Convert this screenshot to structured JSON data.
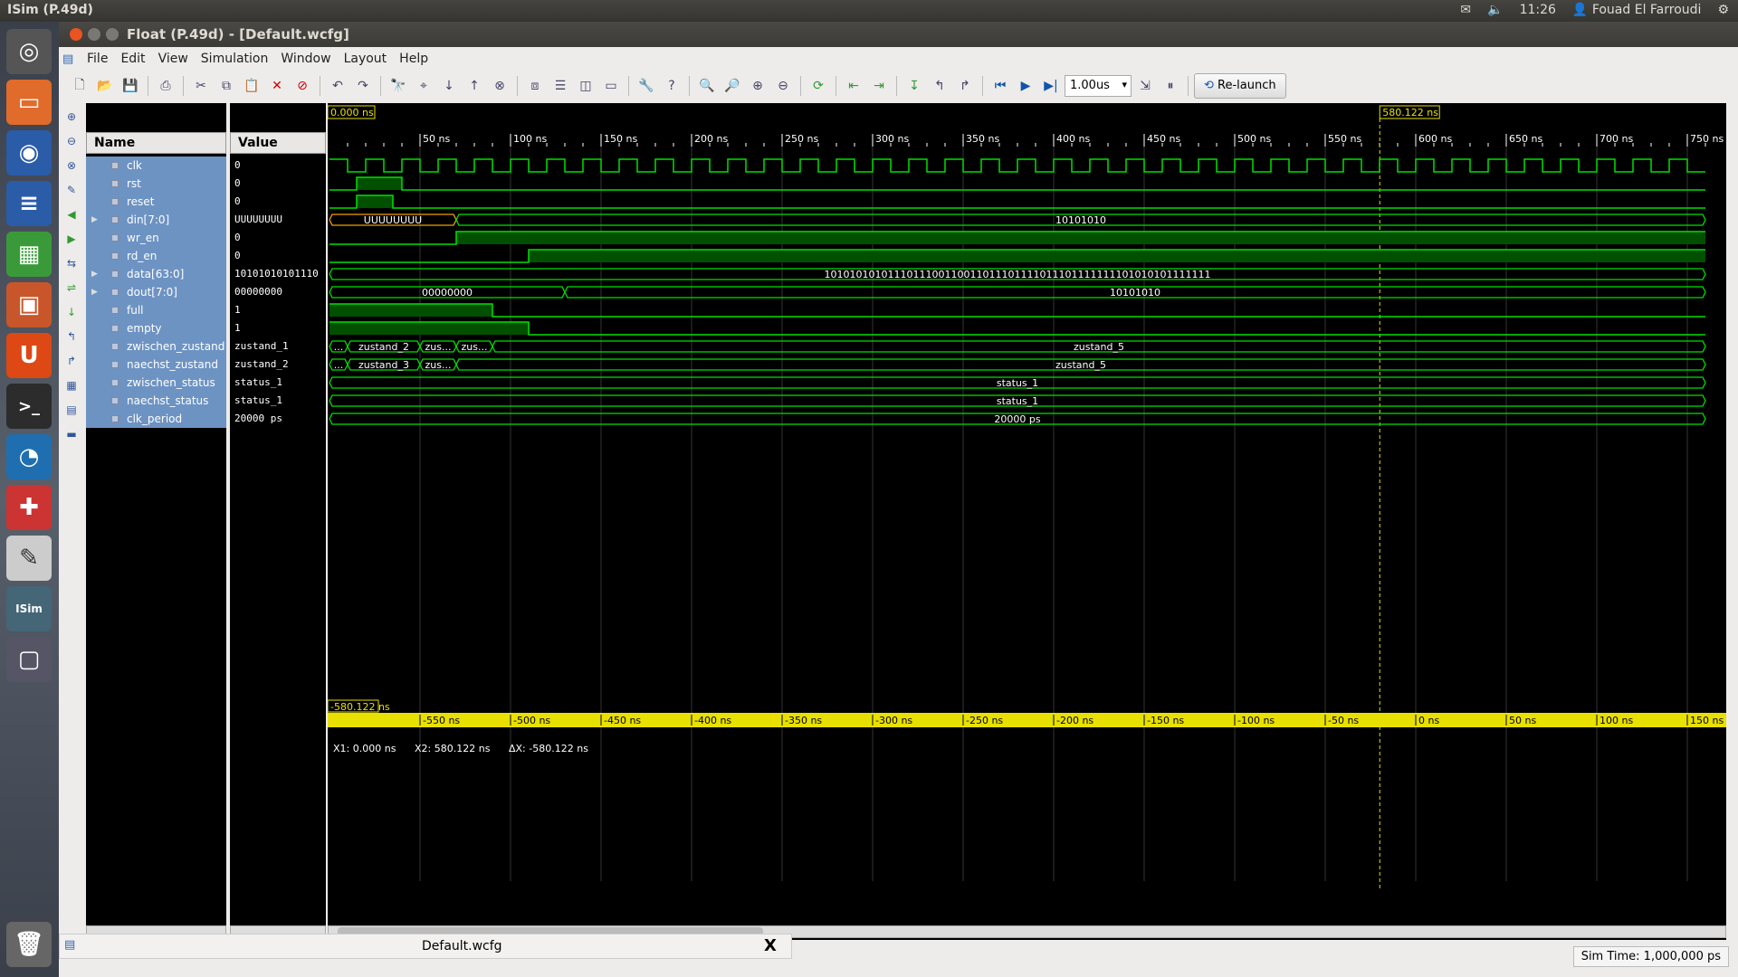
{
  "topbar": {
    "app_title": "ISim (P.49d)",
    "clock": "11:26",
    "user": "Fouad El Farroudi"
  },
  "window": {
    "title": "Float (P.49d) - [Default.wcfg]"
  },
  "menu": [
    "File",
    "Edit",
    "View",
    "Simulation",
    "Window",
    "Layout",
    "Help"
  ],
  "toolbar": {
    "run_time": "1.00us",
    "relaunch_label": "Re-launch"
  },
  "panels": {
    "name_header": "Name",
    "value_header": "Value"
  },
  "signals": [
    {
      "name": "clk",
      "value": "0",
      "expandable": false
    },
    {
      "name": "rst",
      "value": "0",
      "expandable": false
    },
    {
      "name": "reset",
      "value": "0",
      "expandable": false
    },
    {
      "name": "din[7:0]",
      "value": "UUUUUUUU",
      "expandable": true
    },
    {
      "name": "wr_en",
      "value": "0",
      "expandable": false
    },
    {
      "name": "rd_en",
      "value": "0",
      "expandable": false
    },
    {
      "name": "data[63:0]",
      "value": "10101010101110",
      "expandable": true
    },
    {
      "name": "dout[7:0]",
      "value": "00000000",
      "expandable": true
    },
    {
      "name": "full",
      "value": "1",
      "expandable": false
    },
    {
      "name": "empty",
      "value": "1",
      "expandable": false
    },
    {
      "name": "zwischen_zustand",
      "value": "zustand_1",
      "expandable": false
    },
    {
      "name": "naechst_zustand",
      "value": "zustand_2",
      "expandable": false
    },
    {
      "name": "zwischen_status",
      "value": "status_1",
      "expandable": false
    },
    {
      "name": "naechst_status",
      "value": "status_1",
      "expandable": false
    },
    {
      "name": "clk_period",
      "value": "20000 ps",
      "expandable": false
    }
  ],
  "wave": {
    "cursor1": "0.000 ns",
    "cursor2": "580.122 ns",
    "delta_marker": "-580.122 ns",
    "top_ticks": [
      "50 ns",
      "100 ns",
      "150 ns",
      "200 ns",
      "250 ns",
      "300 ns",
      "350 ns",
      "400 ns",
      "450 ns",
      "500 ns",
      "550 ns",
      "600 ns",
      "650 ns",
      "700 ns",
      "750 ns"
    ],
    "bottom_ticks": [
      "-550 ns",
      "-500 ns",
      "-450 ns",
      "-400 ns",
      "-350 ns",
      "-300 ns",
      "-250 ns",
      "-200 ns",
      "-150 ns",
      "-100 ns",
      "-50 ns",
      "0 ns",
      "50 ns",
      "100 ns",
      "150 ns"
    ],
    "labels": {
      "din_a": "UUUUUUUU",
      "din_b": "10101010",
      "data": "1010101010111011100110011011101111011101111111101010101111111",
      "dout_a": "00000000",
      "dout_b": "10101010",
      "zz_1": "zustand_2",
      "zz_2": "zus...",
      "zz_3": "zus...",
      "zz_4": "zustand_5",
      "nz_1": "zustand_3",
      "nz_2": "zus...",
      "nz_3": "zustand_5",
      "zs": "status_1",
      "ns": "status_1",
      "cp": "20000 ps",
      "ellipsis": "..."
    },
    "measure": {
      "x1": "X1: 0.000 ns",
      "x2": "X2: 580.122 ns",
      "dx": "ΔX: -580.122 ns"
    }
  },
  "doc_tab": {
    "name": "Default.wcfg",
    "close": "X"
  },
  "sim_time": "Sim Time: 1,000,000 ps"
}
